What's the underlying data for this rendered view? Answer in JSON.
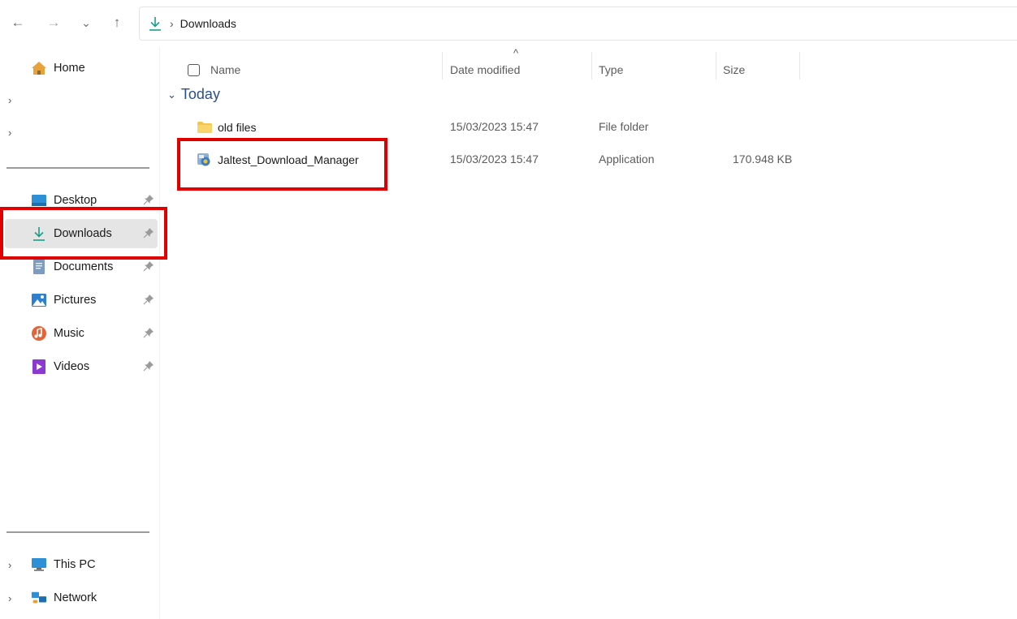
{
  "nav": {
    "back_glyph": "←",
    "forward_glyph": "→",
    "recent_glyph": "⌄",
    "up_glyph": "↑"
  },
  "address": {
    "separator": "›",
    "crumb": "Downloads"
  },
  "sidebar": {
    "home": "Home",
    "quick_access": [
      {
        "label": "Desktop",
        "icon": "desktop-icon"
      },
      {
        "label": "Downloads",
        "icon": "download-arrow-icon"
      },
      {
        "label": "Documents",
        "icon": "documents-icon"
      },
      {
        "label": "Pictures",
        "icon": "pictures-icon"
      },
      {
        "label": "Music",
        "icon": "music-icon"
      },
      {
        "label": "Videos",
        "icon": "videos-icon"
      }
    ],
    "selected": "Downloads",
    "this_pc": "This PC",
    "network": "Network"
  },
  "columns": {
    "name": "Name",
    "date_modified": "Date modified",
    "type": "Type",
    "size": "Size",
    "sort_glyph": "^"
  },
  "group": {
    "label": "Today",
    "caret": "⌄"
  },
  "files": [
    {
      "name": "old files",
      "date": "15/03/2023 15:47",
      "type": "File folder",
      "size": "",
      "icon": "folder-icon"
    },
    {
      "name": "Jaltest_Download_Manager",
      "date": "15/03/2023 15:47",
      "type": "Application",
      "size": "170.948 KB",
      "icon": "application-icon"
    }
  ],
  "colors": {
    "highlight": "#e00000",
    "group_header": "#2b4e8c",
    "selected_bg": "#e5e5e5"
  }
}
